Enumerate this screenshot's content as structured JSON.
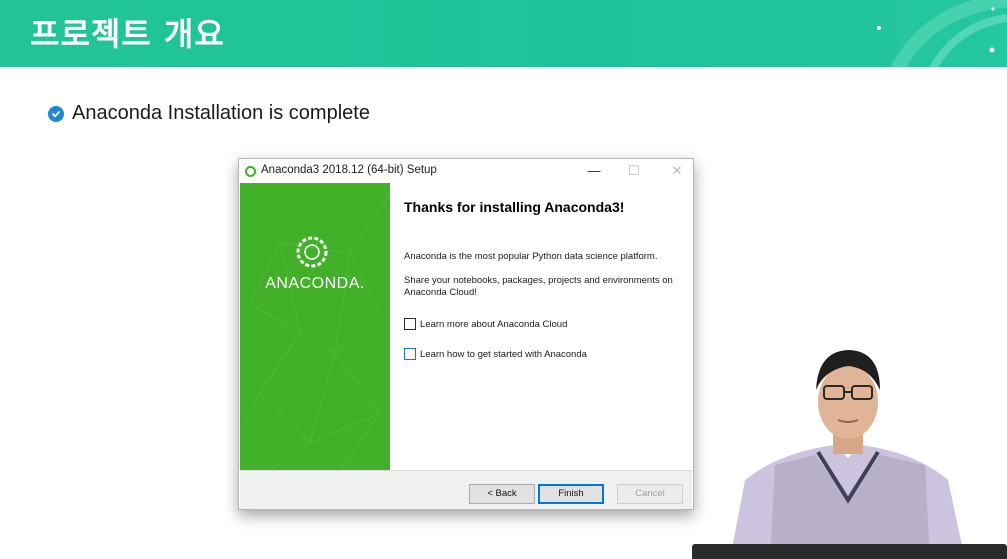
{
  "banner": {
    "title": "프로젝트 개요",
    "bg_color": "#22c497"
  },
  "bullet": {
    "icon": "check-circle-icon",
    "icon_color": "#1e88d6",
    "text": "Anaconda Installation is complete"
  },
  "window": {
    "title": "Anaconda3 2018.12 (64-bit) Setup",
    "controls": {
      "minimize": "—",
      "maximize": "☐",
      "close": "✕"
    },
    "brand_color": "#43b02a",
    "brand_wordmark": "ANACONDA.",
    "heading": "Thanks for installing Anaconda3!",
    "description_1": "Anaconda is the most popular Python data science platform.",
    "description_2": "Share your notebooks, packages, projects and environments on Anaconda Cloud!",
    "checkboxes": [
      {
        "label": "Learn more about Anaconda Cloud",
        "checked": false
      },
      {
        "label": "Learn how to get started with Anaconda",
        "checked": false
      }
    ],
    "buttons": {
      "back": "< Back",
      "finish": "Finish",
      "cancel": "Cancel"
    }
  }
}
